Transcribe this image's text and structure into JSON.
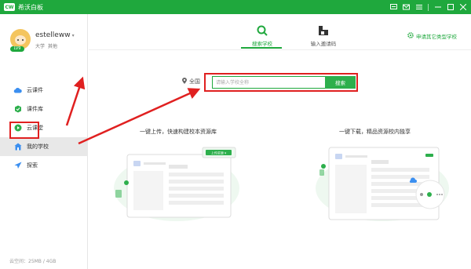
{
  "app": {
    "logo_text": "CW",
    "title": "希沃白板"
  },
  "user": {
    "name": "estelleww",
    "level": "LV9",
    "school_type": "大学",
    "role": "其他"
  },
  "nav": [
    {
      "label": "云课件",
      "icon": "cloud-icon"
    },
    {
      "label": "课件库",
      "icon": "library-icon"
    },
    {
      "label": "云课堂",
      "icon": "classroom-icon"
    },
    {
      "label": "我的学校",
      "icon": "school-icon"
    },
    {
      "label": "探索",
      "icon": "explore-icon"
    }
  ],
  "quota": "云空间：25MB / 4GB",
  "tabs": [
    {
      "label": "搜索学校",
      "icon": "search-icon"
    },
    {
      "label": "输入邀请码",
      "icon": "invite-code-icon"
    }
  ],
  "apply_link": "申请其它类型学校",
  "search": {
    "region": "全国",
    "placeholder": "请输入学校全称",
    "button": "搜索"
  },
  "promo": {
    "left_text": "一键上传，快速构建校本资源库",
    "right_text": "一键下载，精品资源校内独享",
    "upload_btn": "上传资源 ▾"
  },
  "colors": {
    "brand": "#1fa83d",
    "annotation": "#e02020"
  }
}
